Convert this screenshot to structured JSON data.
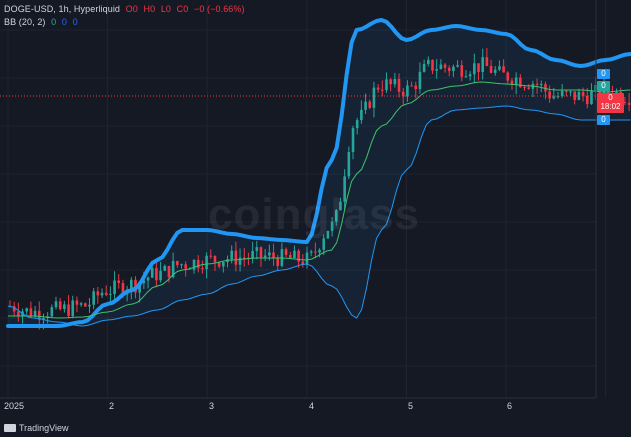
{
  "header": {
    "symbol": "DOGE-USD, 1h, Hyperliquid",
    "open": "O0",
    "high": "H0",
    "low": "L0",
    "close": "C0",
    "change": "−0 (−0.66%)",
    "indicator": "BB (20, 2)",
    "basis": "0",
    "upper": "0",
    "lower": "0"
  },
  "price_tags": {
    "upper": "0",
    "basis": "0",
    "price": "0",
    "countdown": "18:02",
    "lower": "0"
  },
  "watermark": "coinglass",
  "branding": "TradingView",
  "colors": {
    "up": "#26a69a",
    "down": "#f23645",
    "upper_band": "#2196f3",
    "basis": "#3cc46b",
    "lower_band": "#2196f3",
    "background": "#151924"
  },
  "chart_data": {
    "type": "line",
    "x_ticks": [
      "2025",
      "2",
      "3",
      "4",
      "5",
      "6"
    ],
    "x": [
      0,
      0.25,
      0.5,
      0.75,
      1,
      1.25,
      1.5,
      1.75,
      2,
      2.25,
      2.5,
      2.75,
      3,
      3.25,
      3.5,
      3.75,
      4,
      4.25,
      4.5,
      4.75,
      5,
      5.25,
      5.5,
      5.75,
      6,
      6.25
    ],
    "series": [
      {
        "name": "",
        "values": [
          0.12,
          0.12,
          0.12,
          0.14,
          0.23,
          0.3,
          0.45,
          0.6,
          0.6,
          0.58,
          0.56,
          0.55,
          0.54,
          0.95,
          1.6,
          1.65,
          1.55,
          1.6,
          1.62,
          1.6,
          1.58,
          1.5,
          1.45,
          1.42,
          1.45,
          1.48
        ]
      },
      {
        "name": "",
        "values": [
          0.17,
          0.17,
          0.16,
          0.165,
          0.19,
          0.23,
          0.32,
          0.4,
          0.43,
          0.45,
          0.46,
          0.46,
          0.45,
          0.5,
          0.88,
          1.12,
          1.23,
          1.3,
          1.32,
          1.34,
          1.33,
          1.32,
          1.3,
          1.3,
          1.29,
          1.3
        ]
      },
      {
        "name": "",
        "values": [
          0.22,
          0.16,
          0.14,
          0.12,
          0.15,
          0.17,
          0.2,
          0.25,
          0.28,
          0.33,
          0.37,
          0.4,
          0.43,
          0.32,
          0.16,
          0.6,
          0.9,
          1.15,
          1.2,
          1.21,
          1.22,
          1.2,
          1.18,
          1.15,
          1.15,
          1.15
        ]
      },
      {
        "name": "",
        "values": [
          0.22,
          0.19,
          0.2,
          0.22,
          0.3,
          0.33,
          0.38,
          0.43,
          0.45,
          0.46,
          0.47,
          0.46,
          0.45,
          0.62,
          1.15,
          1.33,
          1.3,
          1.42,
          1.41,
          1.42,
          1.37,
          1.34,
          1.27,
          1.27,
          1.29,
          1.27
        ]
      }
    ]
  }
}
